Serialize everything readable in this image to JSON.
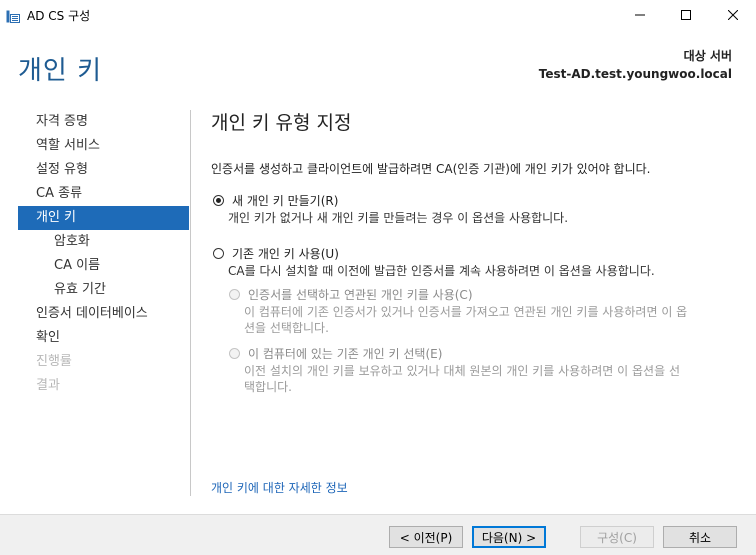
{
  "window": {
    "title": "AD CS 구성",
    "icons": [
      "app-icon",
      "minimize-icon",
      "maximize-icon",
      "close-icon"
    ]
  },
  "header": {
    "page_title": "개인 키",
    "target_label": "대상 서버",
    "target_value": "Test-AD.test.youngwoo.local"
  },
  "sidebar": {
    "items": [
      {
        "label": "자격 증명",
        "state": "normal"
      },
      {
        "label": "역할 서비스",
        "state": "normal"
      },
      {
        "label": "설정 유형",
        "state": "normal"
      },
      {
        "label": "CA 종류",
        "state": "normal"
      },
      {
        "label": "개인 키",
        "state": "active"
      },
      {
        "label": "암호화",
        "state": "sub"
      },
      {
        "label": "CA 이름",
        "state": "sub"
      },
      {
        "label": "유효 기간",
        "state": "sub"
      },
      {
        "label": "인증서 데이터베이스",
        "state": "normal"
      },
      {
        "label": "확인",
        "state": "normal"
      },
      {
        "label": "진행률",
        "state": "disabled"
      },
      {
        "label": "결과",
        "state": "disabled"
      }
    ]
  },
  "main": {
    "section_title": "개인 키 유형 지정",
    "intro": "인증서를 생성하고 클라이언트에 발급하려면 CA(인증 기관)에 개인 키가 있어야 합니다.",
    "options": {
      "new_key": {
        "label": "새 개인 키 만들기(R)",
        "desc": "개인 키가 없거나 새 개인 키를 만들려는 경우 이 옵션을 사용합니다.",
        "checked": true
      },
      "existing_key": {
        "label": "기존 개인 키 사용(U)",
        "desc": "CA를 다시 설치할 때 이전에 발급한 인증서를 계속 사용하려면 이 옵션을 사용합니다.",
        "checked": false
      },
      "select_cert": {
        "label": "인증서를 선택하고 연관된 개인 키를 사용(C)",
        "desc_line1": "이 컴퓨터에 기존 인증서가 있거나 인증서를 가져오고 연관된 개인 키를 사용하려면 이 옵",
        "desc_line2": "션을 선택합니다.",
        "enabled": false
      },
      "select_key": {
        "label": "이 컴퓨터에 있는 기존 개인 키 선택(E)",
        "desc_line1": "이전 설치의 개인 키를 보유하고 있거나 대체 원본의 개인 키를 사용하려면 이 옵션을 선",
        "desc_line2": "택합니다.",
        "enabled": false
      }
    },
    "more_link": "개인 키에 대한 자세한 정보"
  },
  "footer": {
    "prev_label": "< 이전(P)",
    "next_label": "다음(N) >",
    "configure_label": "구성(C)",
    "cancel_label": "취소"
  }
}
